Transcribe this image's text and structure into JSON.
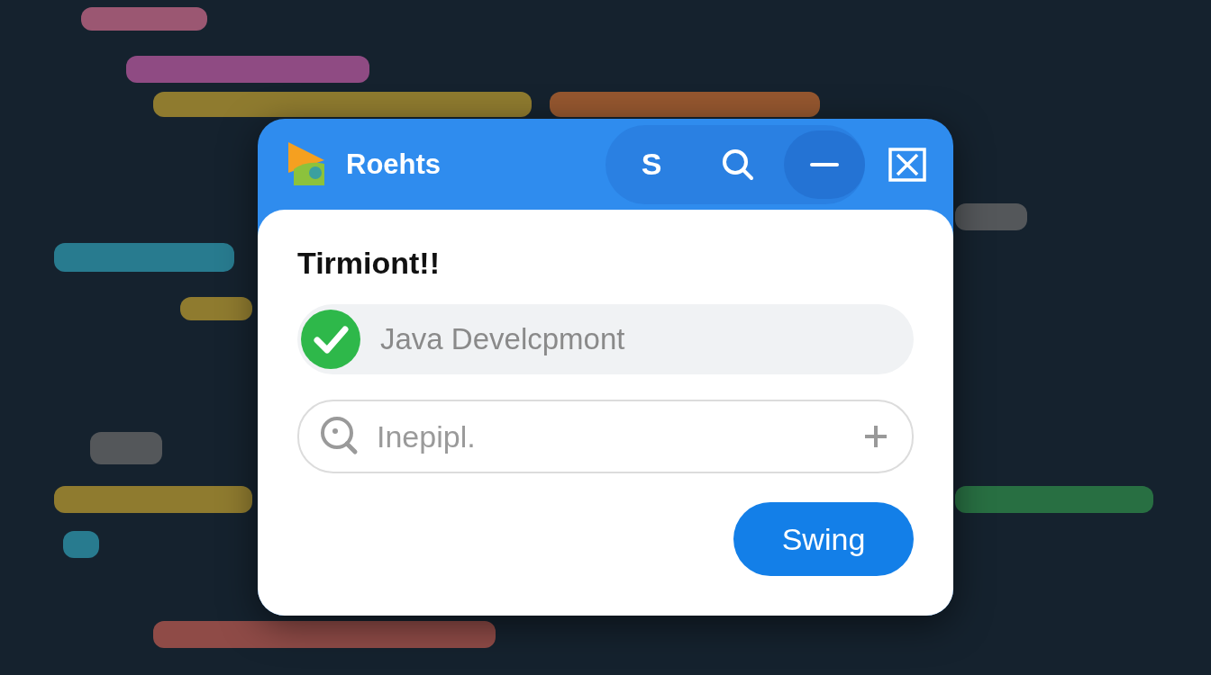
{
  "window": {
    "title": "Roehts"
  },
  "toolbar": [
    {
      "kind": "letter",
      "label": "S",
      "selected": false
    },
    {
      "kind": "search",
      "selected": false
    },
    {
      "kind": "minimize",
      "selected": true
    }
  ],
  "heading": "Tirmiont!!",
  "option": {
    "label": "Java Develcpmont",
    "checked": true
  },
  "search": {
    "placeholder": "Inepipl."
  },
  "buttons": [
    {
      "label": "Swing"
    }
  ]
}
